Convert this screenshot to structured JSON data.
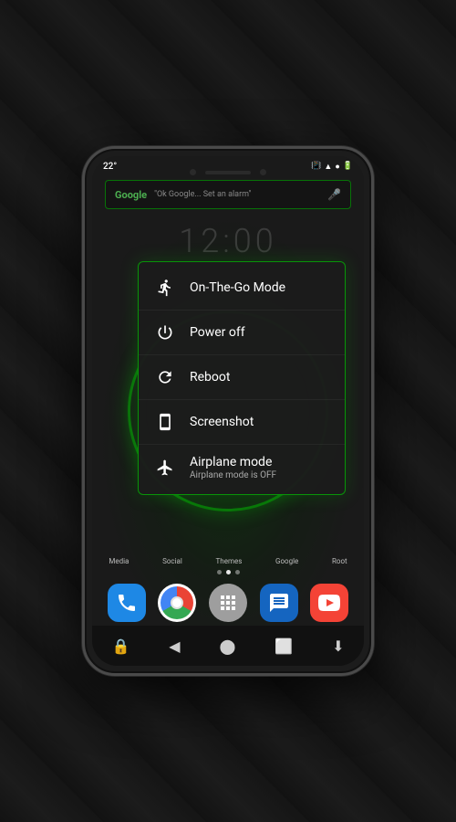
{
  "background": {
    "color": "#1a1a1a"
  },
  "status_bar": {
    "time": "22°",
    "icons": [
      "vibrate",
      "wifi",
      "signal",
      "battery"
    ]
  },
  "search_bar": {
    "brand": "Google",
    "placeholder": "\"Ok Google... Set an alarm\"",
    "mic_icon": "mic"
  },
  "clock": {
    "time": "12:00"
  },
  "power_menu": {
    "items": [
      {
        "id": "on-the-go",
        "icon": "walking",
        "label": "On-The-Go Mode",
        "sublabel": ""
      },
      {
        "id": "power-off",
        "icon": "power",
        "label": "Power off",
        "sublabel": ""
      },
      {
        "id": "reboot",
        "icon": "reboot",
        "label": "Reboot",
        "sublabel": ""
      },
      {
        "id": "screenshot",
        "icon": "screenshot",
        "label": "Screenshot",
        "sublabel": ""
      },
      {
        "id": "airplane",
        "icon": "airplane",
        "label": "Airplane mode",
        "sublabel": "Airplane mode is OFF"
      }
    ]
  },
  "dock": {
    "labels": [
      "Media",
      "Social",
      "Themes",
      "Google",
      "Root"
    ],
    "apps": [
      {
        "id": "phone",
        "name": "Phone"
      },
      {
        "id": "chrome",
        "name": "Chrome"
      },
      {
        "id": "grid",
        "name": "Apps"
      },
      {
        "id": "messages",
        "name": "Messages"
      },
      {
        "id": "youtube",
        "name": "YouTube"
      }
    ],
    "dots": [
      false,
      true,
      false
    ]
  },
  "nav_bar": {
    "icons": [
      "lock",
      "back",
      "home",
      "recent",
      "download"
    ]
  }
}
